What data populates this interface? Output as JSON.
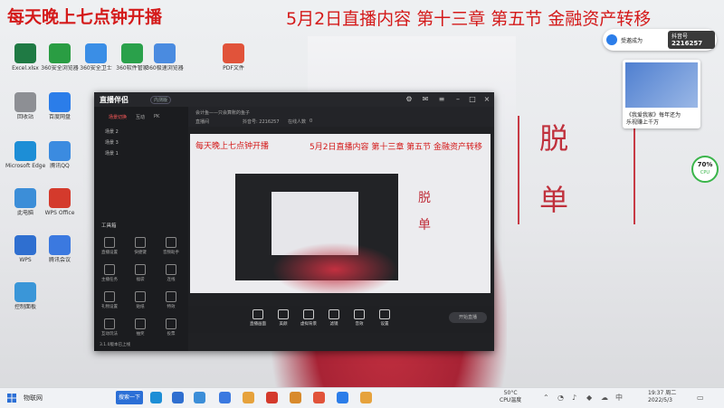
{
  "banner": {
    "left": "每天晚上七点钟开播",
    "right": "5月2日直播内容 第十三章 第五节 金融资产转移"
  },
  "side_chars": [
    "脱",
    "单"
  ],
  "desktop_icons": [
    {
      "label": "360安全浏览器",
      "color": "#2a9d43"
    },
    {
      "label": "360安全卫士",
      "color": "#3a8ee6"
    },
    {
      "label": "PDF文件",
      "color": "#e1533a"
    },
    {
      "label": "Excel.xlsx",
      "color": "#1f7a44"
    },
    {
      "label": "腾讯QQ",
      "color": "#3b8be0"
    },
    {
      "label": "360极速浏览器",
      "color": "#4a8be0"
    },
    {
      "label": "回收站",
      "color": "#8d8f94"
    },
    {
      "label": "百度网盘",
      "color": "#2b7de9"
    },
    {
      "label": "Microsoft Edge",
      "color": "#1d8ed6"
    },
    {
      "label": "WPS Office",
      "color": "#d43a2c"
    },
    {
      "label": "此电脑",
      "color": "#3c8ed8"
    },
    {
      "label": "WPS",
      "color": "#2f6fd0"
    },
    {
      "label": "控制面板",
      "color": "#3a96d8"
    },
    {
      "label": "360软件管家",
      "color": "#2aa14b"
    },
    {
      "label": "腾讯会议",
      "color": "#3b79e0"
    }
  ],
  "app": {
    "logo": "直播伴侣",
    "version": "内测版",
    "scene_tabs": [
      "场景切换",
      "互动",
      "PK"
    ],
    "scenes": [
      "场景 2",
      "场景 3",
      "场景 1"
    ],
    "tools_title": "工具箱",
    "tools": [
      "直播设置",
      "快捷键",
      "音频助手",
      "主播任务",
      "福袋",
      "连线",
      "礼物设置",
      "贴纸",
      "特效",
      "互动玩法",
      "抽奖",
      "投票"
    ],
    "footer": "3.1.0版本已上线",
    "preview_bar": [
      "会计鱼——只会算账的鱼子",
      "直播间",
      "抖音号: 2216257",
      "在线人数",
      "0"
    ],
    "bottom_buttons": [
      "直播画面",
      "美颜",
      "虚拟背景",
      "滤镜",
      "音效",
      "设置"
    ],
    "live_button": "开始直播"
  },
  "notify": {
    "text": "受邀成为",
    "badge_top": "抖音号",
    "badge_num": "2216257"
  },
  "news": {
    "line1": "《我爱我家》每年还为",
    "line2": "乐视赚上千万"
  },
  "gauge": {
    "value": "70%",
    "sub": "CPU"
  },
  "taskbar": {
    "weather": "物联网",
    "search": "搜索一下",
    "temp": "50°C",
    "temp_sub": "CPU温度",
    "time": "19:37 周二",
    "date": "2022/5/3",
    "colors": {
      "accent": "#2b6fd6",
      "brand_red": "#d41a1a"
    }
  }
}
